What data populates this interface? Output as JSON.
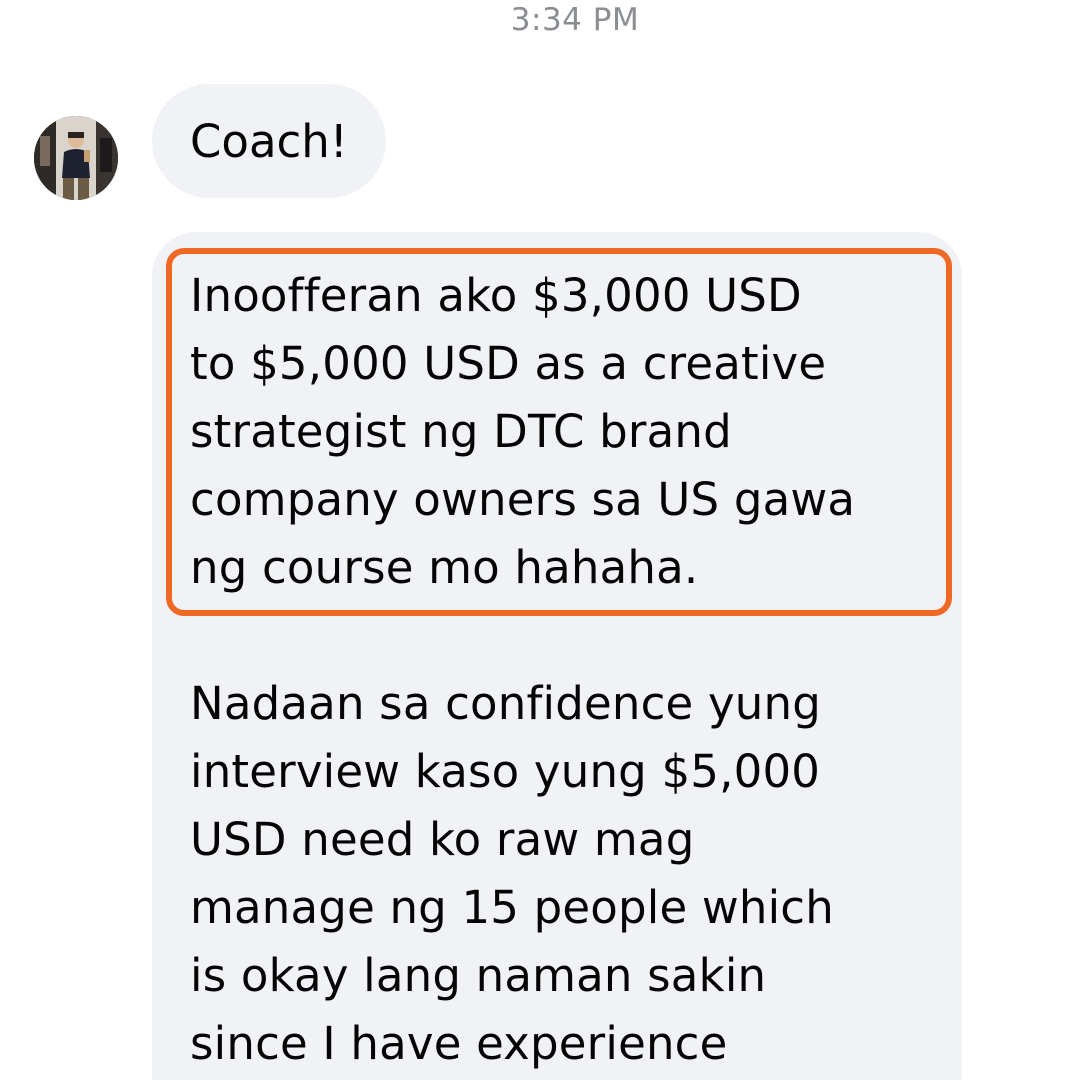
{
  "thread": {
    "timestamp": "3:34 PM"
  },
  "messages": [
    {
      "text": "Coach!"
    },
    {
      "highlighted_paragraph": "Inoofferan ako $3,000 USD\nto $5,000 USD as a creative\nstrategist ng DTC brand\ncompany owners sa US gawa\nng course mo hahaha.",
      "paragraph_2": "Nadaan sa confidence yung\ninterview kaso yung $5,000\nUSD need ko raw mag\nmanage ng 15 people which\nis okay lang naman sakin\nsince I have experience"
    }
  ],
  "colors": {
    "bubble_background": "#f0f2f5",
    "highlight_border": "#ee6a24",
    "timestamp_text": "#8a8d91",
    "message_text": "#050505"
  },
  "icons": {
    "sender_avatar": "avatar"
  }
}
